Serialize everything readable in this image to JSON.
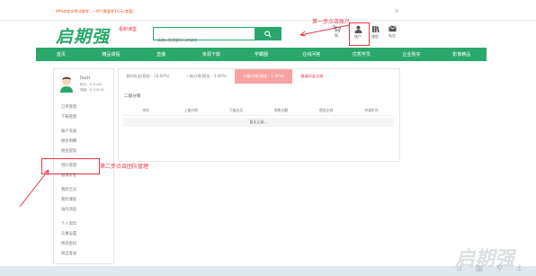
{
  "topbar": {
    "notice": "99%的定向考试都考…—件只需要考3万元(查看)",
    "close_glyph": "×"
  },
  "header": {
    "logo": "启期强",
    "logo_sub": "看积课堂",
    "search_placeholder": "请输入您想要学习的课程",
    "icons": [
      {
        "icon": "cart-icon",
        "label": "购"
      },
      {
        "icon": "user-icon",
        "label": "账户"
      },
      {
        "icon": "book-icon",
        "label": "课程"
      },
      {
        "icon": "mail-icon",
        "label": "私信"
      }
    ]
  },
  "annotations": {
    "step1": "第一步点击账户",
    "step2": "第二步点击团队管理",
    "color": "#e33344"
  },
  "nav": {
    "items": [
      "首页",
      "精品课程",
      "直播",
      "资源下载",
      "学霸圈",
      "在线问答",
      "优秀学员",
      "企业购买",
      "影像精品"
    ]
  },
  "sidebar": {
    "username": "hum",
    "stats": [
      "积分：¥ 10.00",
      "佣金：¥ 100.00"
    ],
    "groups": [
      [
        "订单管理",
        "下载管理"
      ],
      [
        "账户充值",
        "佣金明细",
        "佣金提现"
      ],
      [
        "团队管理",
        "邀请好友"
      ],
      [
        "我的全员",
        "我的课程",
        "站内消息"
      ],
      [
        "个人资料",
        "头像设置",
        "修改密码",
        "退出登录"
      ]
    ]
  },
  "main": {
    "tabs": [
      {
        "label": "我的收益(佣金：10.00%)",
        "state": "normal"
      },
      {
        "label": "一级分销(佣金：3.00%)",
        "state": "normal"
      },
      {
        "label": "二级分销(佣金：1.00%)",
        "state": "active"
      },
      {
        "label": "邀请好友注册",
        "state": "invite"
      }
    ],
    "section_title": "二级分销",
    "table_headers": [
      "排名",
      "上级分销",
      "下级会员",
      "销售总额",
      "佣金比例",
      "申请时间"
    ],
    "empty_text": "暂无记录…"
  },
  "watermark": {
    "text": "启期强",
    "icons": "⌂ ▦ ⚲ ⚓"
  },
  "colors": {
    "brand_green": "#2aa86b",
    "active_tab": "#f7a2a2",
    "annotation_red": "#e33344"
  }
}
